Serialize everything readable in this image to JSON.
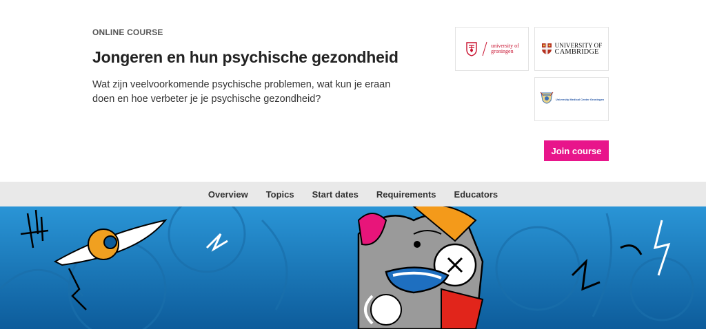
{
  "course": {
    "kicker": "ONLINE COURSE",
    "title": "Jongeren en hun psychische gezondheid",
    "description": "Wat zijn veelvoorkomende psychische problemen, wat kun je eraan doen en hoe verbeter je je psychische gezondheid?"
  },
  "partners": {
    "rug": {
      "line1": "university of",
      "line2": "groningen"
    },
    "cambridge": {
      "line1": "UNIVERSITY OF",
      "line2": "CAMBRIDGE"
    },
    "umcg": {
      "text": "University Medical Center Groningen"
    }
  },
  "cta": {
    "join_label": "Join course"
  },
  "nav": {
    "items": [
      {
        "label": "Overview"
      },
      {
        "label": "Topics"
      },
      {
        "label": "Start dates"
      },
      {
        "label": "Requirements"
      },
      {
        "label": "Educators"
      }
    ]
  },
  "colors": {
    "accent": "#e8158b",
    "subnav_bg": "#e9e9e9",
    "banner_blue": "#1e7fc4"
  },
  "banner": {
    "icon": "illustration-banner"
  }
}
